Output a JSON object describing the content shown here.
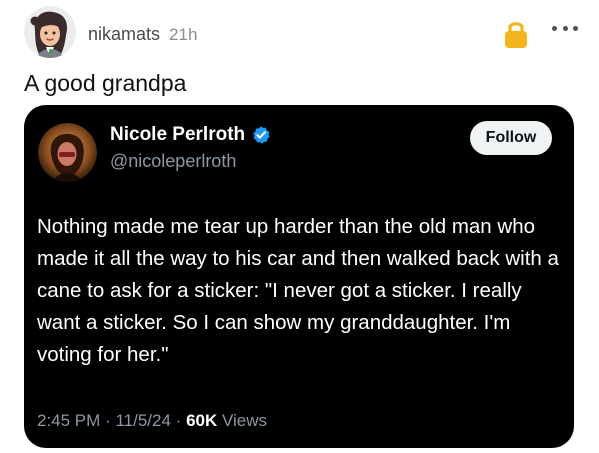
{
  "post": {
    "author": "nikamats",
    "timestamp": "21h",
    "title": "A good grandpa",
    "icons": {
      "avatar": "user-avatar",
      "lock": "lock-icon",
      "more": "more-icon"
    },
    "colors": {
      "lock": "#f2b51d",
      "text": "#111111"
    }
  },
  "tweet": {
    "display_name": "Nicole Perlroth",
    "handle": "@nicoleperlroth",
    "follow_label": "Follow",
    "text": "Nothing made me tear up harder than the old man who made it all the way to his car and then walked back with a cane to ask for a sticker: \"I never got a sticker. I really want a sticker. So I can show my granddaughter. I'm voting for her.\"",
    "time": "2:45 PM",
    "date": "11/5/24",
    "views_count": "60K",
    "views_label": "Views",
    "separator": "·",
    "icons": {
      "avatar": "profile-photo",
      "verified": "verified-badge-icon"
    },
    "colors": {
      "card_background": "#000000",
      "verified": "#1d9bf0",
      "secondary_text": "#8b98a5",
      "follow_background": "#eff3f4"
    }
  }
}
